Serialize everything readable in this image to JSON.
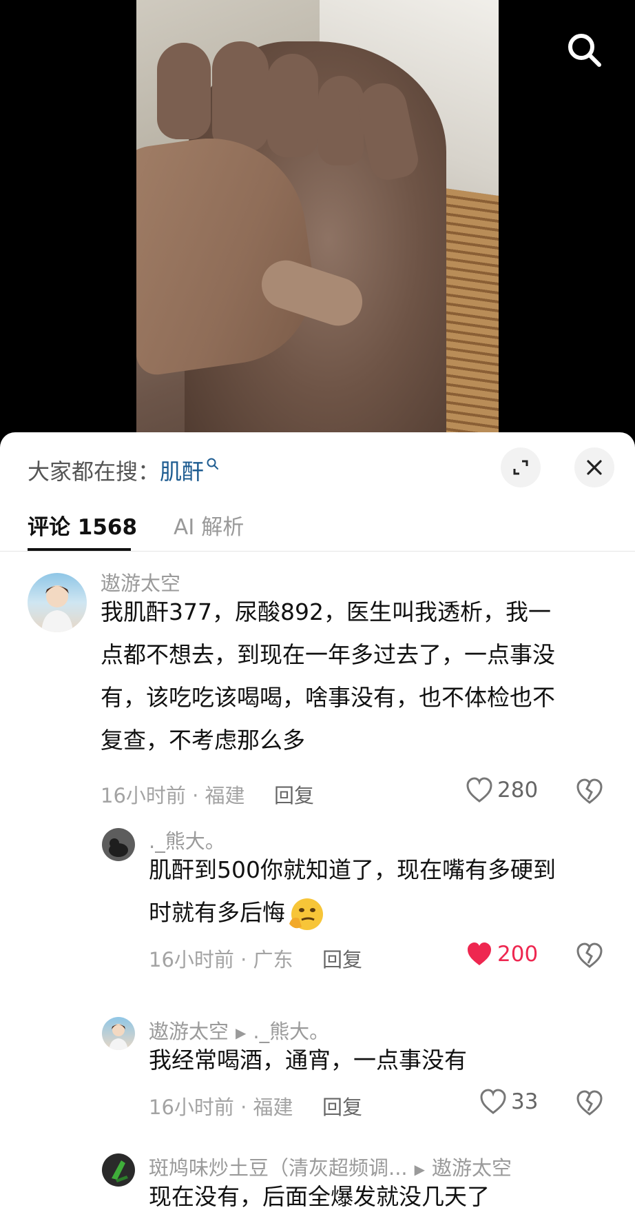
{
  "trending": {
    "prefix": "大家都在搜：",
    "keyword": "肌酐"
  },
  "tabs": {
    "comments_label": "评论 1568",
    "ai_label": "AI 解析"
  },
  "comments": [
    {
      "user": "遨游太空",
      "text": [
        "我肌酐377，尿酸892，医生叫我透析，我一",
        "点都不想去，到现在一年多过去了，一点事没",
        "有，该吃吃该喝喝，啥事没有，也不体检也不",
        "复查，不考虑那么多"
      ],
      "meta": "16小时前 · 福建",
      "reply_label": "回复",
      "likes": "280",
      "liked": false
    },
    {
      "user": "._熊大。",
      "text": [
        "肌酐到500你就知道了，现在嘴有多硬到",
        "时就有多后悔"
      ],
      "meta": "16小时前 · 广东",
      "reply_label": "回复",
      "likes": "200",
      "liked": true
    },
    {
      "user": "遨游太空",
      "reply_to": "._熊大。",
      "text": [
        "我经常喝酒，通宵，一点事没有"
      ],
      "meta": "16小时前 · 福建",
      "reply_label": "回复",
      "likes": "33",
      "liked": false
    },
    {
      "user": "斑鸠味炒土豆（清灰超频调...",
      "reply_to": "遨游太空",
      "text": [
        "现在没有，后面全爆发就没几天了"
      ]
    }
  ],
  "colors": {
    "like_active": "#ee2750",
    "keyword": "#1e5c91"
  },
  "icons": {
    "search": "search-icon",
    "expand": "expand-icon",
    "close": "close-icon",
    "like": "heart-icon",
    "dislike": "broken-heart-icon"
  }
}
